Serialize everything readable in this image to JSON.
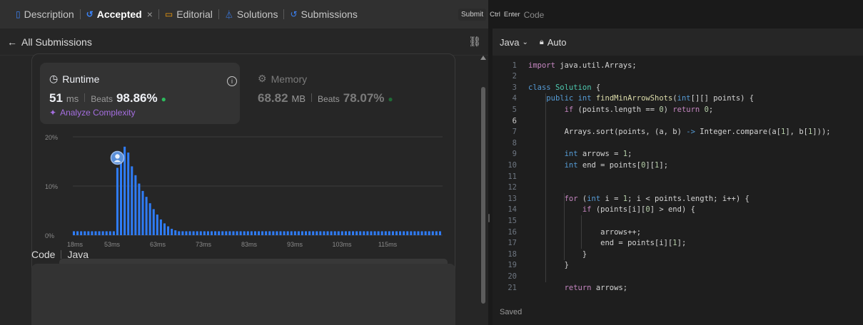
{
  "tabs": [
    {
      "label": "Description",
      "icon": "document-icon",
      "color": "#3b82f6"
    },
    {
      "label": "Accepted",
      "icon": "history-icon",
      "color": "#3b82f6",
      "active": true
    },
    {
      "label": "Editorial",
      "icon": "book-icon",
      "color": "#f59e0b"
    },
    {
      "label": "Solutions",
      "icon": "flask-icon",
      "color": "#3b82f6"
    },
    {
      "label": "Submissions",
      "icon": "history-icon",
      "color": "#3b82f6"
    }
  ],
  "tab_close": "×",
  "subbar": {
    "back_label": "All Submissions"
  },
  "runtime": {
    "title": "Runtime",
    "value": "51",
    "unit": "ms",
    "beats_label": "Beats",
    "percent": "98.86%",
    "analyze": "Analyze Complexity"
  },
  "memory": {
    "title": "Memory",
    "value": "68.82",
    "unit": "MB",
    "beats_label": "Beats",
    "percent": "78.07%"
  },
  "chart_data": {
    "type": "bar",
    "yticks": [
      "20%",
      "10%",
      "0%"
    ],
    "ylim": [
      0,
      20
    ],
    "xticks": [
      "18ms",
      "53ms",
      "63ms",
      "73ms",
      "83ms",
      "93ms",
      "103ms",
      "115ms"
    ],
    "values": [
      0.8,
      0.8,
      0.8,
      0.8,
      0.8,
      0.8,
      0.8,
      0.8,
      0.8,
      0.8,
      0.8,
      0.8,
      13.7,
      16.0,
      18.0,
      16.8,
      14.0,
      12.2,
      10.5,
      9.0,
      7.8,
      6.5,
      5.3,
      4.2,
      3.2,
      2.4,
      1.8,
      1.3,
      1.0,
      0.8,
      0.8,
      0.8,
      0.8,
      0.8,
      0.8,
      0.8,
      0.8,
      0.8,
      0.8,
      0.8,
      0.8,
      0.8,
      0.8,
      0.8,
      0.8,
      0.8,
      0.8,
      0.8,
      0.8,
      0.8,
      0.8,
      0.8,
      0.8,
      0.8,
      0.8,
      0.8,
      0.8,
      0.8,
      0.8,
      0.8,
      0.8,
      0.8,
      0.8,
      0.8,
      0.8,
      0.8,
      0.8,
      0.8,
      0.8,
      0.8,
      0.8,
      0.8,
      0.8,
      0.8,
      0.8,
      0.8,
      0.8,
      0.8,
      0.8,
      0.8,
      0.8,
      0.8,
      0.8,
      0.8,
      0.8,
      0.8,
      0.8,
      0.8,
      0.8,
      0.8,
      0.8,
      0.8,
      0.8,
      0.8,
      0.8,
      0.8,
      0.8,
      0.8,
      0.8,
      0.8,
      0.8,
      0.8
    ],
    "user_bar_index": 12,
    "color": "#2f7cf6"
  },
  "code_section": {
    "label": "Code",
    "lang": "Java"
  },
  "editor": {
    "language": "Java",
    "mode": "Auto",
    "status": "Saved",
    "lines": [
      "import java.util.Arrays;",
      "",
      "class Solution {",
      "    public int findMinArrowShots(int[][] points) {",
      "        if (points.length == 0) return 0;",
      "",
      "        Arrays.sort(points, (a, b) -> Integer.compare(a[1], b[1]));",
      "",
      "        int arrows = 1;",
      "        int end = points[0][1];",
      "",
      "",
      "        for (int i = 1; i < points.length; i++) {",
      "            if (points[i][0] > end) {",
      "",
      "                arrows++;",
      "                end = points[i][1];",
      "            }",
      "        }",
      "",
      "        return arrows;"
    ]
  },
  "submit": {
    "label": "Submit",
    "kbd1": "Ctrl",
    "kbd2": "Enter",
    "ghost": "Code"
  }
}
